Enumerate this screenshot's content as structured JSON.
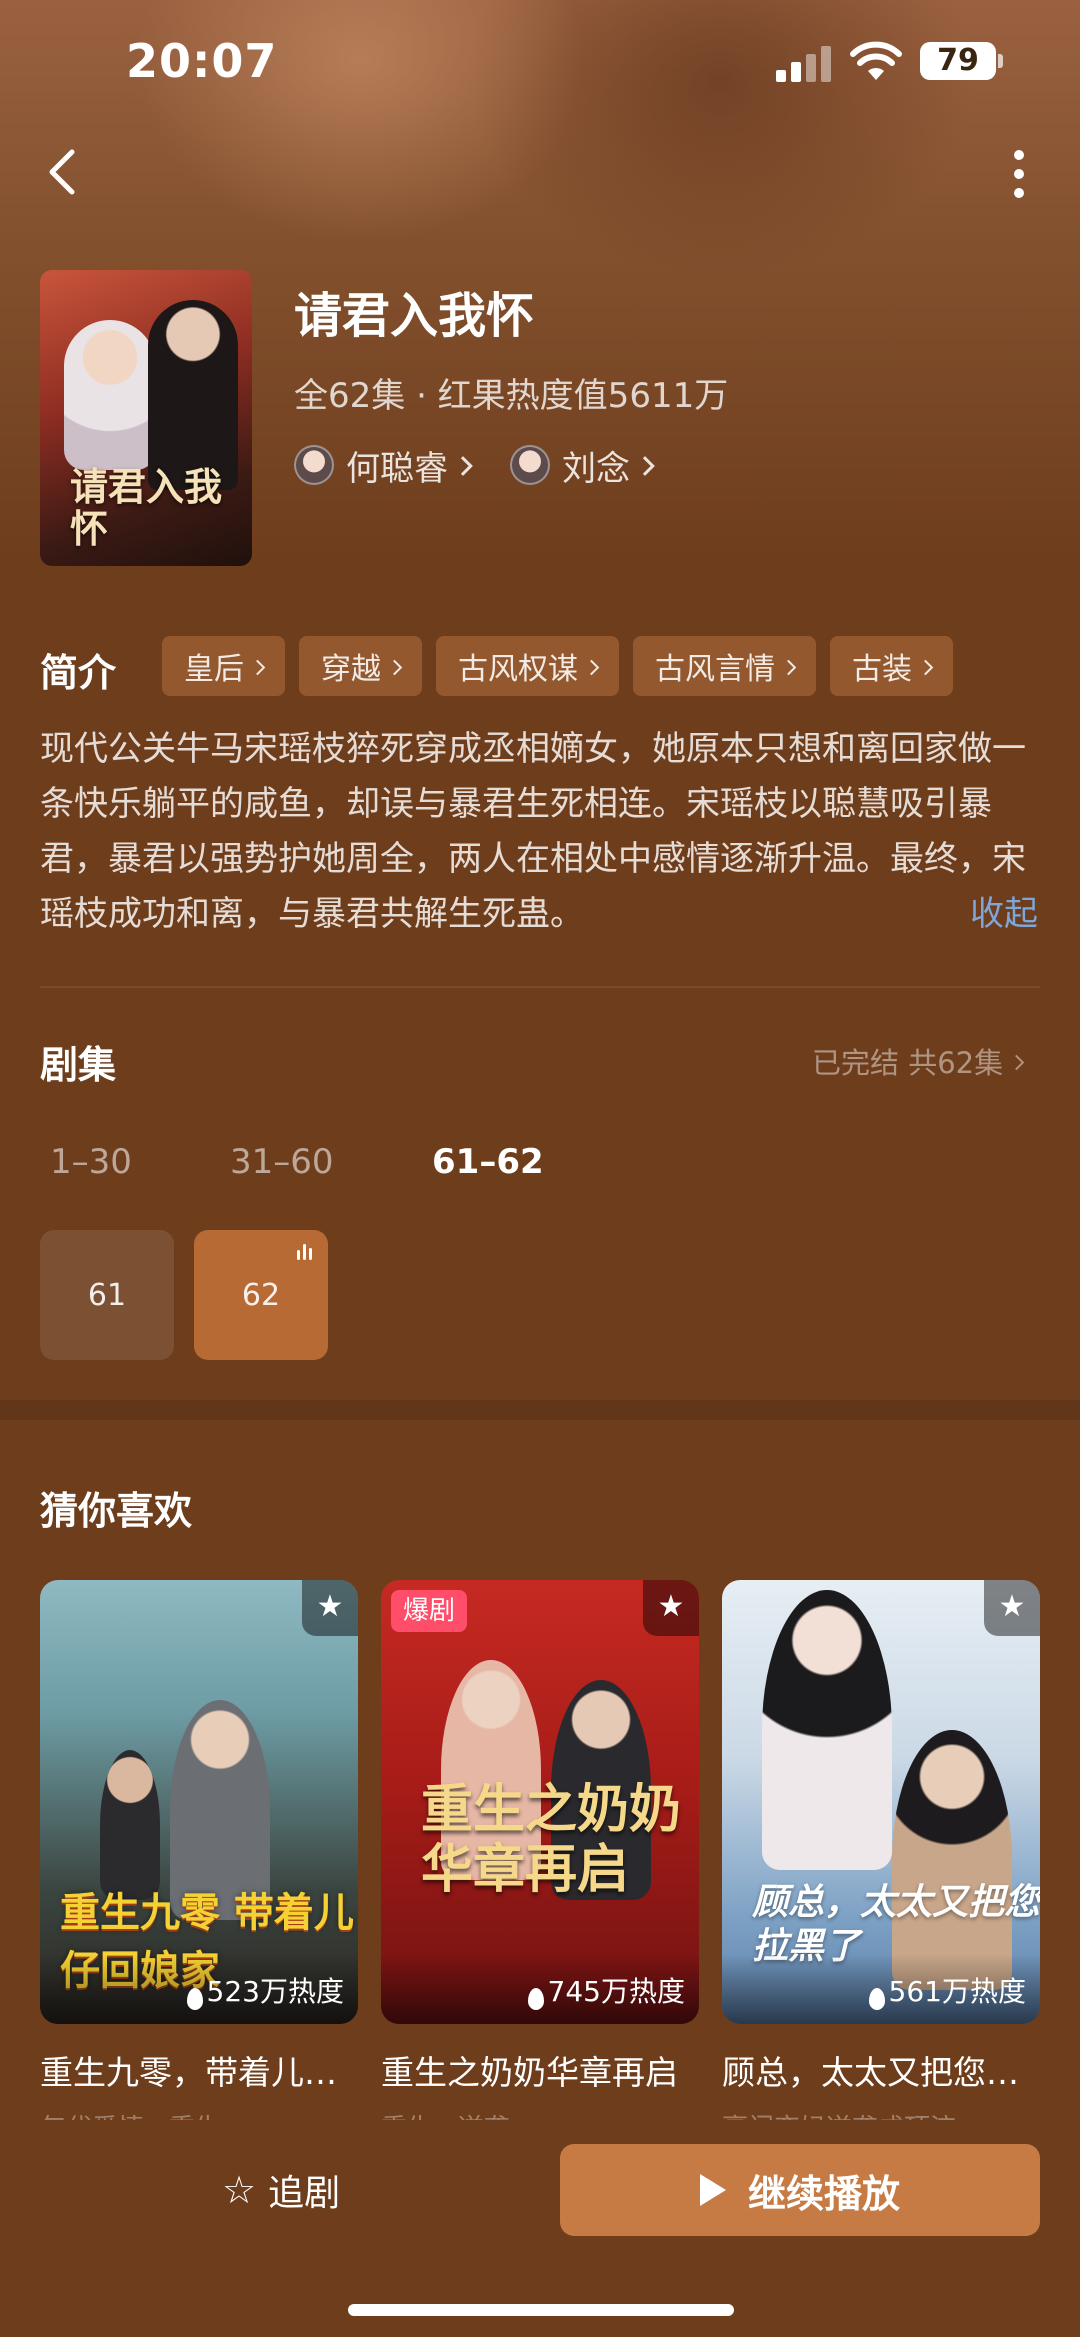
{
  "status_bar": {
    "time": "20:07",
    "battery": "79"
  },
  "show": {
    "title": "请君入我怀",
    "poster_title": "请君入我怀",
    "meta": "全62集 · 红果热度值5611万",
    "actors": [
      "何聪睿",
      "刘念"
    ]
  },
  "intro": {
    "heading": "简介",
    "tags": [
      "皇后",
      "穿越",
      "古风权谋",
      "古风言情",
      "古装"
    ],
    "description": "现代公关牛马宋瑶枝猝死穿成丞相嫡女，她原本只想和离回家做一条快乐躺平的咸鱼，却误与暴君生死相连。宋瑶枝以聪慧吸引暴君，暴君以强势护她周全，两人在相处中感情逐渐升温。最终，宋瑶枝成功和离，与暴君共解生死蛊。",
    "collapse_label": "收起"
  },
  "episodes": {
    "heading": "剧集",
    "status": "已完结 共62集",
    "ranges": [
      "1–30",
      "31–60",
      "61–62"
    ],
    "active_range": "61–62",
    "items": [
      "61",
      "62"
    ],
    "current": "62"
  },
  "recommend": {
    "heading": "猜你喜欢",
    "cards": [
      {
        "title": "重生九零，带着儿…",
        "subtitle": "年代爱情 · 重生",
        "heat": "523万热度",
        "art_text": "重生九零 带着儿仔回娘家",
        "badge": ""
      },
      {
        "title": "重生之奶奶华章再启",
        "subtitle": "重生 · 逆袭",
        "heat": "745万热度",
        "art_text": "重生之奶奶华章再启",
        "badge": "爆剧"
      },
      {
        "title": "顾总，太太又把您…",
        "subtitle": "豪门恋妈逆袭成顶流",
        "heat": "561万热度",
        "art_text": "顾总，太太又把您拉黑了",
        "badge": ""
      }
    ]
  },
  "bottom_bar": {
    "follow_label": "追剧",
    "play_label": "继续播放"
  },
  "colors": {
    "background": "#6e3d1c",
    "accent": "#c67a44",
    "link": "#7ea6d8",
    "badge": "#ff4d6a"
  }
}
